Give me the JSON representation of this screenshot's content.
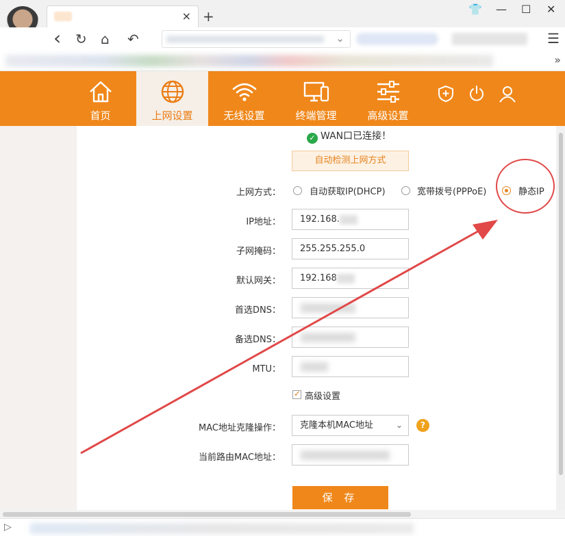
{
  "browser": {
    "tab_close": "×",
    "new_tab": "+",
    "window_controls": {
      "skin": "👕",
      "minimize": "—",
      "maximize": "☐",
      "close": "✕"
    },
    "nav": {
      "back": "‹",
      "reload": "↻",
      "home": "⌂",
      "undo": "↶",
      "menu": "☰",
      "url_chevron": "⌄"
    },
    "bookmarks_more": "»",
    "status_toggle": "▷"
  },
  "router_nav": {
    "items": [
      {
        "label": "首页",
        "icon": "home-icon",
        "active": false
      },
      {
        "label": "上网设置",
        "icon": "globe-icon",
        "active": true
      },
      {
        "label": "无线设置",
        "icon": "wifi-icon",
        "active": false
      },
      {
        "label": "终端管理",
        "icon": "devices-icon",
        "active": false
      },
      {
        "label": "高级设置",
        "icon": "sliders-icon",
        "active": false
      }
    ],
    "right_icons": [
      "shield-icon",
      "power-icon",
      "user-icon"
    ]
  },
  "status": {
    "text": "WAN口已连接！",
    "check": "✓"
  },
  "detect_button": "自动检测上网方式",
  "connection_type": {
    "label": "上网方式：",
    "options": [
      "自动获取IP(DHCP)",
      "宽带拨号(PPPoE)",
      "静态IP"
    ],
    "selected": "静态IP"
  },
  "fields": {
    "ip": {
      "label": "IP地址：",
      "value": "192.168."
    },
    "subnet": {
      "label": "子网掩码：",
      "value": "255.255.255.0"
    },
    "gateway": {
      "label": "默认网关：",
      "value": "192.168"
    },
    "dns1": {
      "label": "首选DNS：",
      "value": ""
    },
    "dns2": {
      "label": "备选DNS：",
      "value": ""
    },
    "mtu": {
      "label": "MTU：",
      "value": ""
    }
  },
  "advanced": {
    "label": "高级设置",
    "checked": true
  },
  "mac_clone": {
    "label": "MAC地址克隆操作：",
    "value": "克隆本机MAC地址",
    "help": "?"
  },
  "current_mac": {
    "label": "当前路由MAC地址：",
    "value": ""
  },
  "save_button": "保 存",
  "colors": {
    "brand_orange": "#f0871a",
    "annotation_red": "#e14848",
    "connected_green": "#2aa84a"
  }
}
